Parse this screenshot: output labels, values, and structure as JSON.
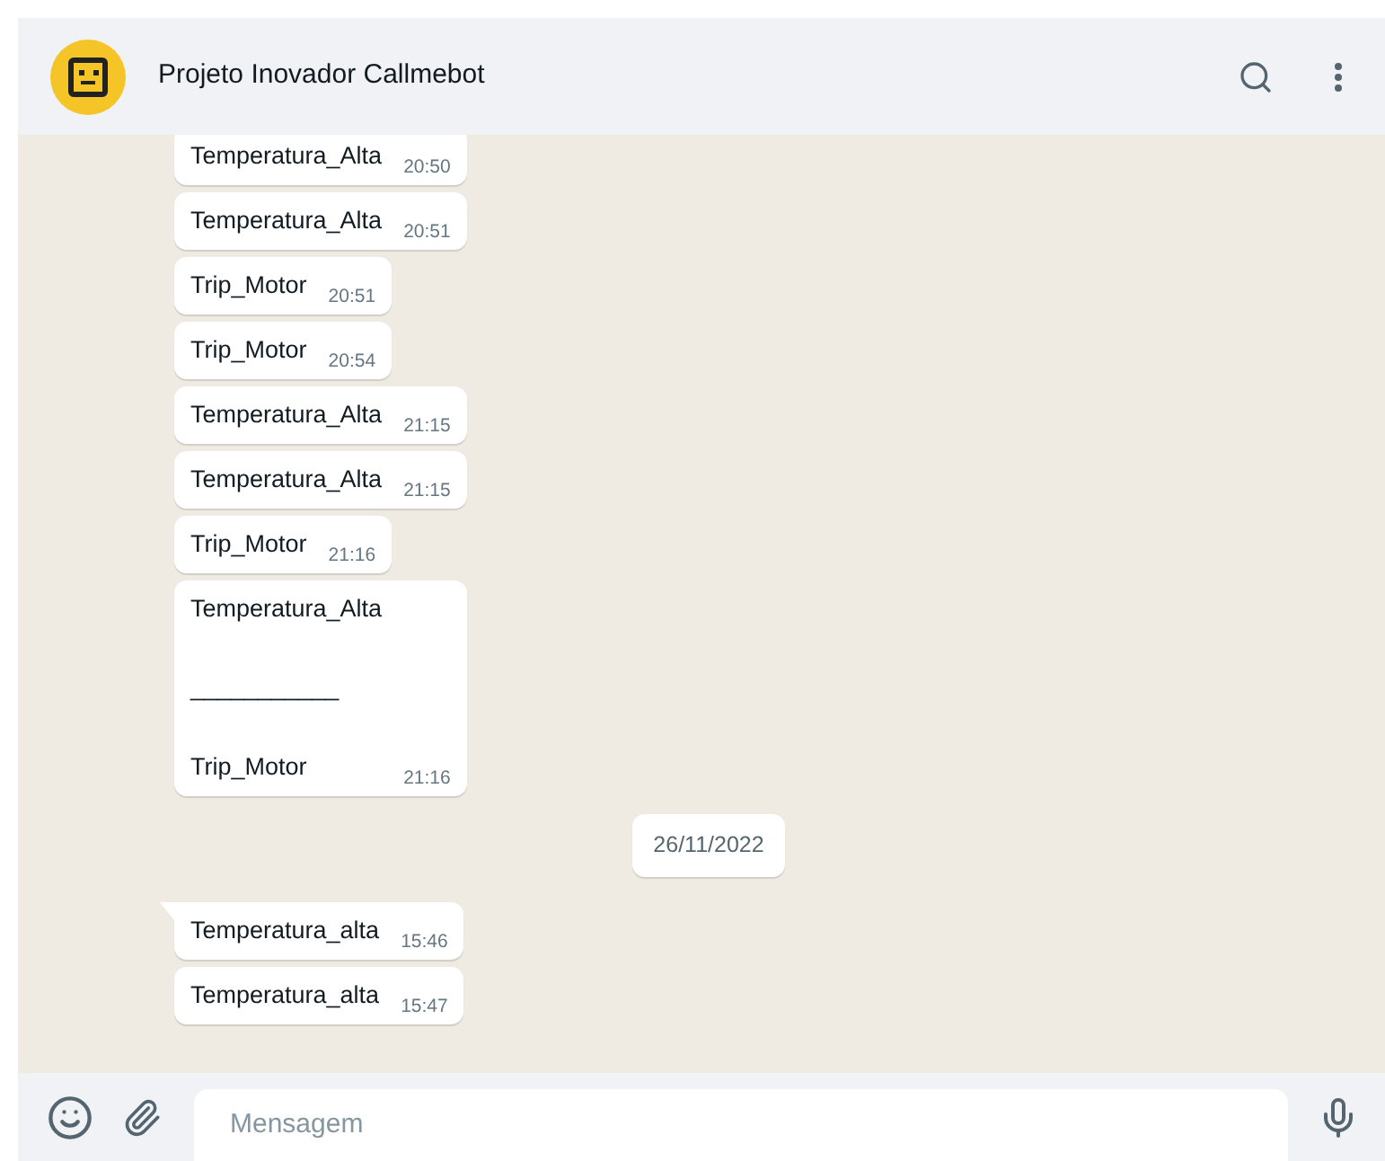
{
  "header": {
    "title": "Projeto Inovador Callmebot"
  },
  "messages": [
    {
      "kind": "message",
      "lines": [
        "Temperatura_Alta"
      ],
      "time": "20:50",
      "tail": false
    },
    {
      "kind": "message",
      "lines": [
        "Temperatura_Alta"
      ],
      "time": "20:51",
      "tail": false
    },
    {
      "kind": "message",
      "lines": [
        "Trip_Motor"
      ],
      "time": "20:51",
      "tail": false
    },
    {
      "kind": "message",
      "lines": [
        "Trip_Motor"
      ],
      "time": "20:54",
      "tail": false
    },
    {
      "kind": "message",
      "lines": [
        "Temperatura_Alta"
      ],
      "time": "21:15",
      "tail": false
    },
    {
      "kind": "message",
      "lines": [
        "Temperatura_Alta"
      ],
      "time": "21:15",
      "tail": false
    },
    {
      "kind": "message",
      "lines": [
        "Trip_Motor"
      ],
      "time": "21:16",
      "tail": false
    },
    {
      "kind": "message",
      "lines": [
        "Temperatura_Alta",
        "___________",
        "Trip_Motor"
      ],
      "time": "21:16",
      "tail": false
    },
    {
      "kind": "date",
      "text": "26/11/2022"
    },
    {
      "kind": "message",
      "lines": [
        "Temperatura_alta"
      ],
      "time": "15:46",
      "tail": true
    },
    {
      "kind": "message",
      "lines": [
        "Temperatura_alta"
      ],
      "time": "15:47",
      "tail": false
    }
  ],
  "composer": {
    "placeholder": "Mensagem"
  }
}
